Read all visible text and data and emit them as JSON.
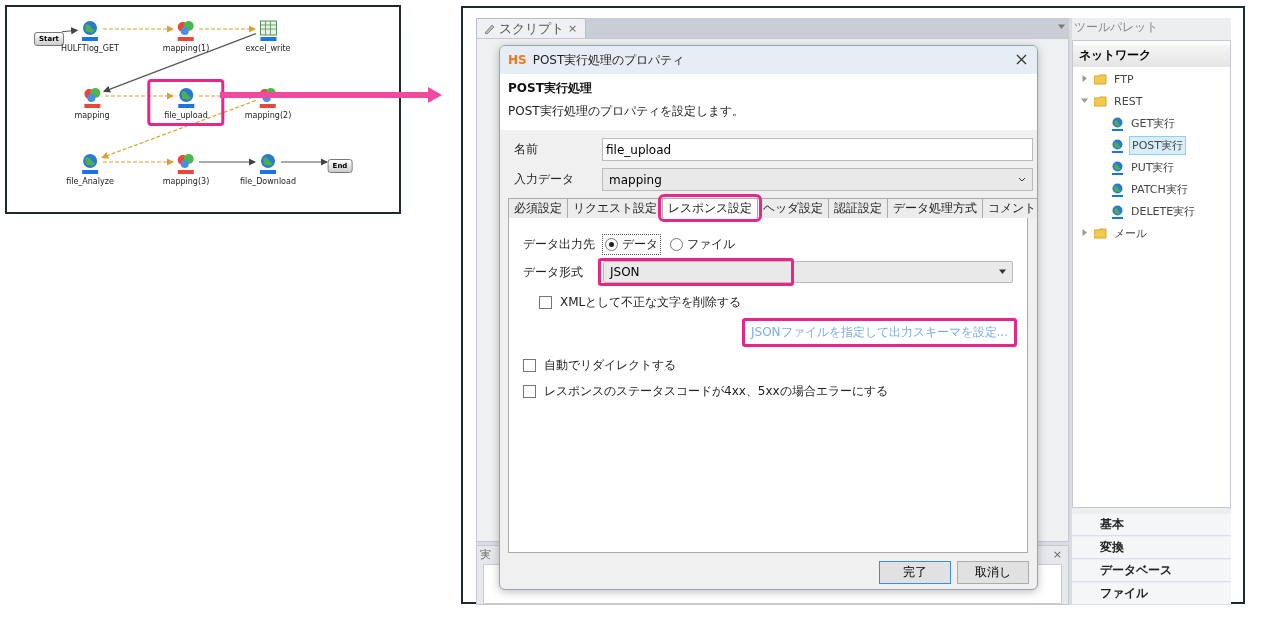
{
  "diagram": {
    "nodes": [
      {
        "kind": "start",
        "label": "Start",
        "highlighted": false
      },
      {
        "kind": "rest",
        "label": "HULFTlog_GET",
        "highlighted": false
      },
      {
        "kind": "mapper",
        "label": "mapping(1)",
        "highlighted": false
      },
      {
        "kind": "excel",
        "label": "excel_write",
        "highlighted": false
      },
      {
        "kind": "mapper",
        "label": "mapping",
        "highlighted": false
      },
      {
        "kind": "rest",
        "label": "file_upload",
        "highlighted": true
      },
      {
        "kind": "mapper",
        "label": "mapping(2)",
        "highlighted": false
      },
      {
        "kind": "rest",
        "label": "file_Analyze",
        "highlighted": false
      },
      {
        "kind": "mapper",
        "label": "mapping(3)",
        "highlighted": false
      },
      {
        "kind": "rest",
        "label": "file_Download",
        "highlighted": false
      },
      {
        "kind": "end",
        "label": "End",
        "highlighted": false
      }
    ],
    "edges": [
      {
        "kind": "flow"
      },
      {
        "kind": "data"
      },
      {
        "kind": "data"
      },
      {
        "kind": "flow"
      },
      {
        "kind": "data"
      },
      {
        "kind": "data"
      },
      {
        "kind": "data"
      },
      {
        "kind": "data"
      },
      {
        "kind": "flow"
      },
      {
        "kind": "flow"
      }
    ]
  },
  "ide": {
    "script_tab": {
      "label": "スクリプト",
      "close": "×"
    },
    "bottom_tab": {
      "label": "実",
      "close": "×"
    },
    "dialog": {
      "logo": "HS",
      "title": "POST実行処理のプロパティ",
      "heading": "POST実行処理",
      "description": "POST実行処理のプロパティを設定します。",
      "fields": [
        {
          "kind": "text",
          "label": "名前",
          "value": "file_upload"
        },
        {
          "kind": "select",
          "label": "入力データ",
          "value": "mapping"
        }
      ],
      "tabs": [
        {
          "label": "必須設定",
          "selected": false,
          "highlighted": false
        },
        {
          "label": "リクエスト設定",
          "selected": false,
          "highlighted": false
        },
        {
          "label": "レスポンス設定",
          "selected": true,
          "highlighted": true
        },
        {
          "label": "ヘッダ設定",
          "selected": false,
          "highlighted": false
        },
        {
          "label": "認証設定",
          "selected": false,
          "highlighted": false
        },
        {
          "label": "データ処理方式",
          "selected": false,
          "highlighted": false
        },
        {
          "label": "コメント",
          "selected": false,
          "highlighted": false
        }
      ],
      "output": {
        "label": "データ出力先",
        "options": [
          {
            "label": "データ",
            "selected": true
          },
          {
            "label": "ファイル",
            "selected": false
          }
        ]
      },
      "format": {
        "label": "データ形式",
        "value": "JSON",
        "highlighted": true
      },
      "rows": [
        {
          "kind": "checkbox",
          "label": "XMLとして不正な文字を削除する",
          "checked": false,
          "indented": true
        },
        {
          "kind": "link",
          "label": "JSONファイルを指定して出力スキーマを設定...",
          "highlighted": true
        },
        {
          "kind": "checkbox",
          "label": "自動でリダイレクトする",
          "checked": false,
          "indented": false
        },
        {
          "kind": "checkbox",
          "label": "レスポンスのステータスコードが4xx、5xxの場合エラーにする",
          "checked": false,
          "indented": false
        }
      ],
      "buttons": [
        {
          "label": "完了",
          "default": true
        },
        {
          "label": "取消し",
          "default": false
        }
      ]
    },
    "palette": {
      "title": "ツールパレット",
      "section": "ネットワーク",
      "tree": [
        {
          "label": "FTP",
          "expanded": false
        },
        {
          "label": "REST",
          "expanded": true,
          "children": [
            {
              "label": "GET実行",
              "selected": false
            },
            {
              "label": "POST実行",
              "selected": true
            },
            {
              "label": "PUT実行",
              "selected": false
            },
            {
              "label": "PATCH実行",
              "selected": false
            },
            {
              "label": "DELETE実行",
              "selected": false
            }
          ]
        },
        {
          "label": "メール",
          "expanded": false
        }
      ],
      "categories": [
        "基本",
        "変換",
        "データベース",
        "ファイル"
      ]
    }
  }
}
